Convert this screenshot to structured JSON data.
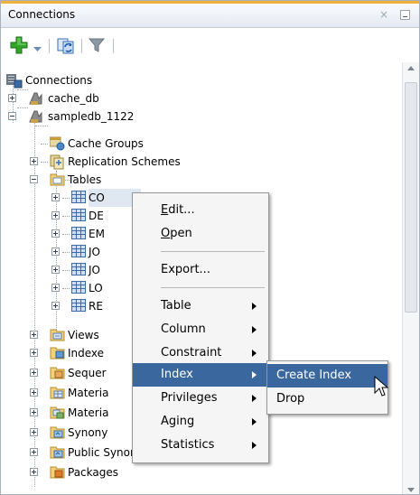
{
  "panel": {
    "title": "Connections",
    "close_glyph": "×"
  },
  "toolbar": [
    {
      "name": "add-connection-icon"
    },
    {
      "name": "dropdown-icon"
    },
    {
      "name": "refresh-icon"
    },
    {
      "name": "filter-icon"
    }
  ],
  "tree": {
    "root": "Connections",
    "cache_db": "cache_db",
    "sampledb": "sampledb_1122",
    "cache_groups": "Cache Groups",
    "replication": "Replication Schemes",
    "tables": "Tables",
    "table_rows": [
      "CO",
      "DE",
      "EM",
      "JO",
      "JO",
      "LO",
      "RE"
    ],
    "views": "Views",
    "indexes": "Indexe",
    "sequences": "Sequer",
    "materialized_1": "Materia",
    "materialized_2": "Materia",
    "synonyms": "Synony",
    "public_synonyms": "Public Synonyms",
    "packages": "Packages"
  },
  "context_menu": {
    "edit_u": "E",
    "edit_rest": "dit...",
    "open_u": "O",
    "open_rest": "pen",
    "export": "Export...",
    "table": "Table",
    "column": "Column",
    "constraint": "Constraint",
    "index": "Index",
    "privileges": "Privileges",
    "aging": "Aging",
    "statistics": "Statistics"
  },
  "submenu": {
    "create_index": "Create Index",
    "drop": "Drop"
  },
  "colors": {
    "highlight": "#3a689e",
    "add_green": "#2fa52a",
    "accent": "#f0b040"
  }
}
